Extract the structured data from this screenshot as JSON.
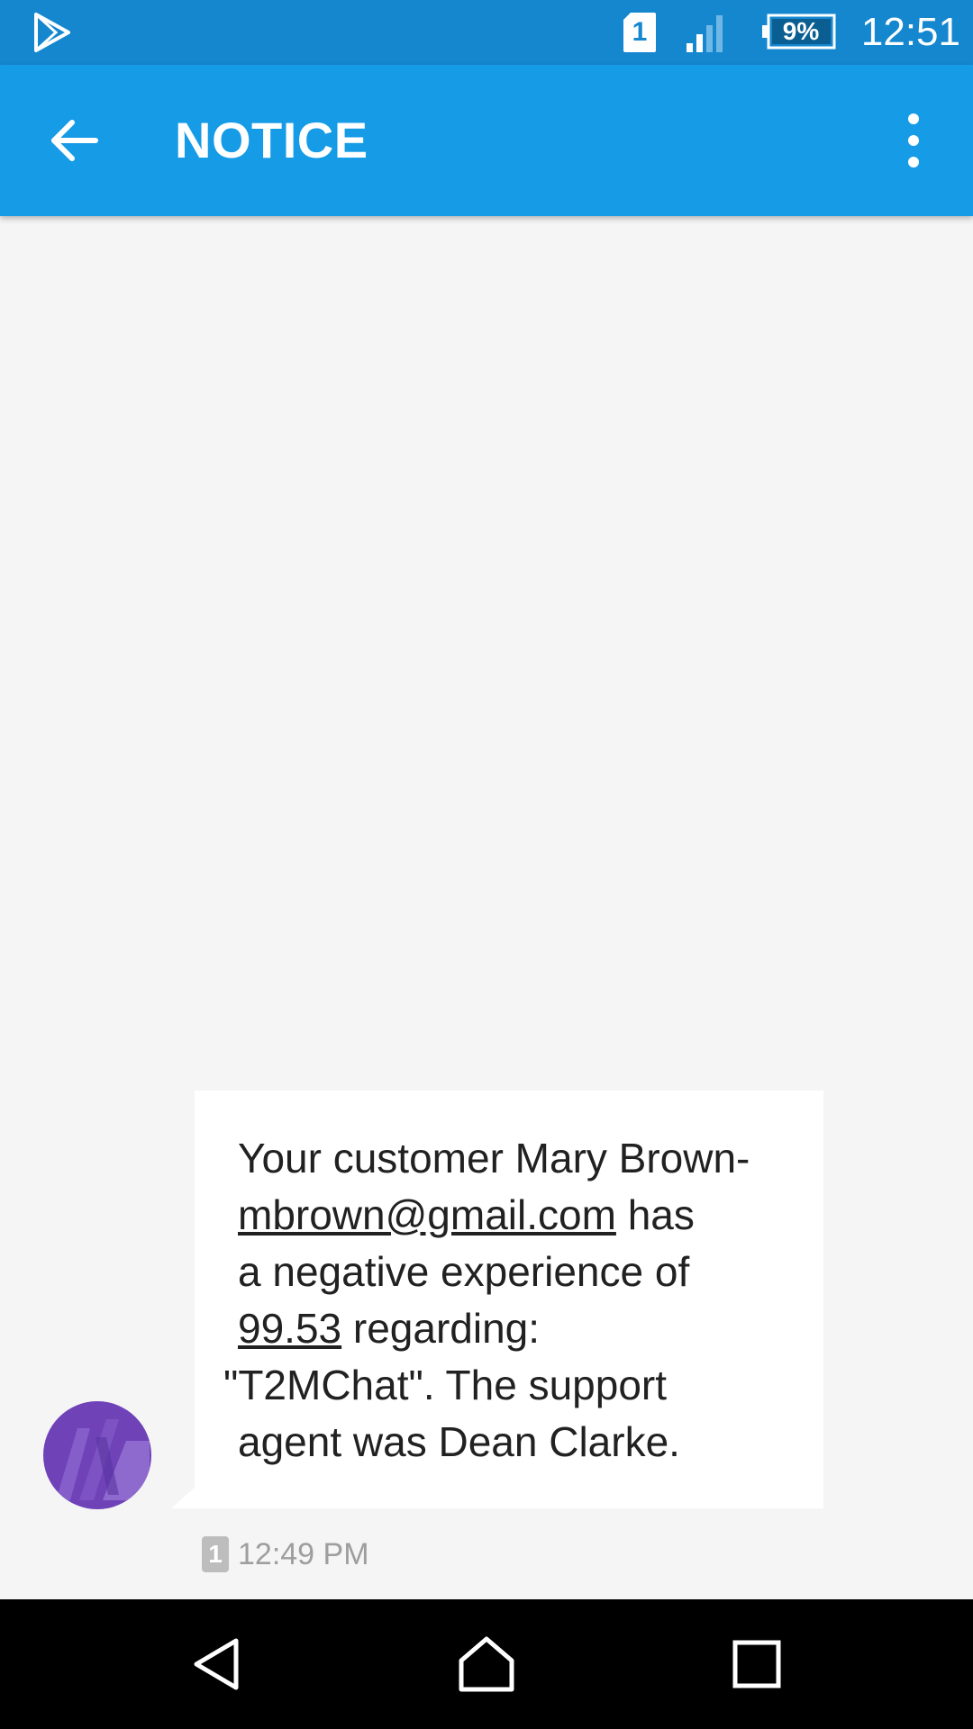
{
  "status_bar": {
    "sim_slot": "1",
    "battery_percent": "9%",
    "time": "12:51",
    "icons": [
      "play-store-icon",
      "sim-card-icon",
      "signal-icon",
      "battery-icon"
    ]
  },
  "app_bar": {
    "title": "NOTICE",
    "back_icon": "arrow-back-icon",
    "menu_icon": "more-vert-icon"
  },
  "message": {
    "lines": [
      {
        "pre": "Your customer Mary Brown-",
        "link": "",
        "post": ""
      },
      {
        "pre": "",
        "link": "mbrown@gmail.com",
        "post": " has"
      },
      {
        "pre": "a negative experience of",
        "link": "",
        "post": ""
      },
      {
        "pre": "",
        "link": "99.53",
        "post": " regarding:"
      },
      {
        "pre": "\"T2MChat\". The support",
        "link": "",
        "post": ""
      },
      {
        "pre": "agent was Dean Clarke.",
        "link": "",
        "post": ""
      }
    ],
    "sim_badge": "1",
    "timestamp": "12:49 PM"
  },
  "colors": {
    "status_bar": "#1587cf",
    "app_bar": "#169be6",
    "background": "#f5f5f5",
    "avatar": "#6f42b8"
  },
  "nav_bar": {
    "icons": [
      "nav-back-icon",
      "nav-home-icon",
      "nav-recents-icon"
    ]
  }
}
